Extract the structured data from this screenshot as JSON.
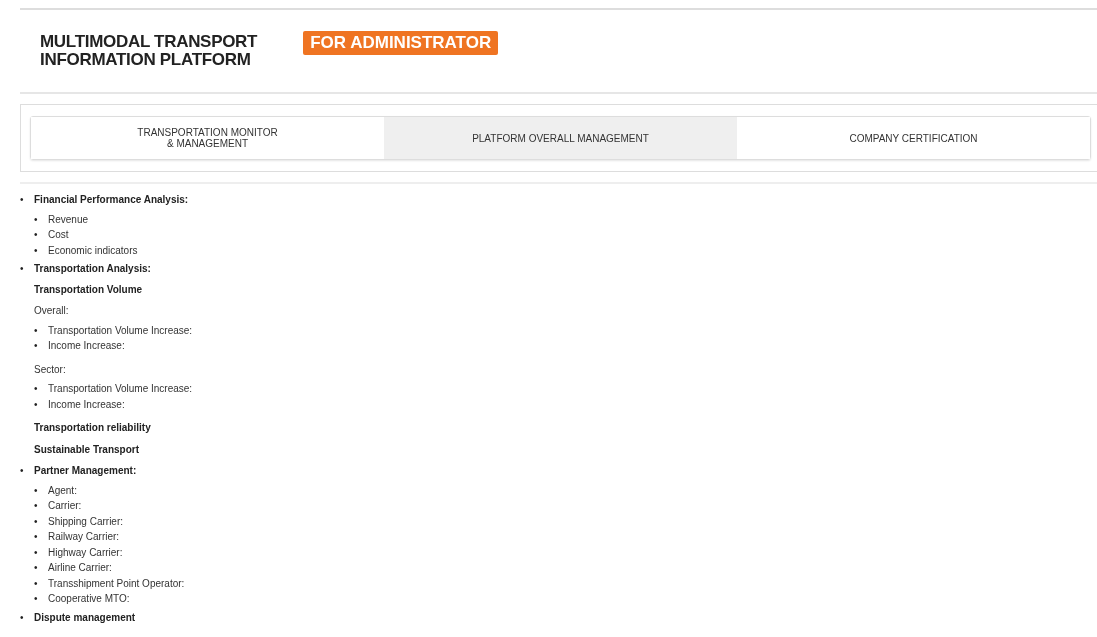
{
  "header": {
    "title_lines": [
      "MULTIMODAL TRANSPORT",
      "INFORMATION PLATFORM"
    ],
    "badge": "FOR ADMINISTRATOR"
  },
  "tabs": [
    {
      "label_lines": [
        "TRANSPORTATION MONITOR",
        "& MANAGEMENT"
      ],
      "selected": false
    },
    {
      "label_lines": [
        "PLATFORM OVERALL MANAGEMENT"
      ],
      "selected": true
    },
    {
      "label_lines": [
        "COMPANY CERTIFICATION"
      ],
      "selected": false
    }
  ],
  "sections": [
    {
      "marker": "•",
      "title": "Financial Performance Analysis:",
      "children": [
        {
          "kind": "item",
          "marker": "•",
          "text": "Revenue"
        },
        {
          "kind": "item",
          "marker": "•",
          "text": "Cost"
        },
        {
          "kind": "item",
          "marker": "•",
          "text": "Economic indicators"
        }
      ]
    },
    {
      "marker": "•",
      "title": "Transportation Analysis:",
      "children": [
        {
          "kind": "heading",
          "text": "Transportation Volume"
        },
        {
          "kind": "group",
          "text": "Overall:",
          "children": [
            {
              "kind": "item",
              "marker": "•",
              "text": "Transportation Volume Increase:"
            },
            {
              "kind": "item",
              "marker": "•",
              "text": "Income Increase:"
            }
          ]
        },
        {
          "kind": "group",
          "text": "Sector:",
          "children": [
            {
              "kind": "item",
              "marker": "•",
              "text": "Transportation Volume Increase:"
            },
            {
              "kind": "item",
              "marker": "•",
              "text": "Income Increase:"
            }
          ]
        },
        {
          "kind": "heading",
          "text": "Transportation reliability"
        },
        {
          "kind": "heading",
          "text": "Sustainable Transport"
        }
      ]
    },
    {
      "marker": "•",
      "title": "Partner Management:",
      "children": [
        {
          "kind": "item",
          "marker": "•",
          "text": "Agent:"
        },
        {
          "kind": "item",
          "marker": "•",
          "text": "Carrier:"
        },
        {
          "kind": "item",
          "marker": "•",
          "text": "Shipping Carrier:"
        },
        {
          "kind": "item",
          "marker": "•",
          "text": "Railway Carrier:"
        },
        {
          "kind": "item",
          "marker": "•",
          "text": "Highway Carrier:"
        },
        {
          "kind": "item",
          "marker": "•",
          "text": "Airline Carrier:"
        },
        {
          "kind": "item",
          "marker": "•",
          "text": "Transshipment Point Operator:"
        },
        {
          "kind": "item",
          "marker": "•",
          "text": "Cooperative MTO:"
        }
      ]
    },
    {
      "marker": "•",
      "title": "Dispute management"
    }
  ]
}
